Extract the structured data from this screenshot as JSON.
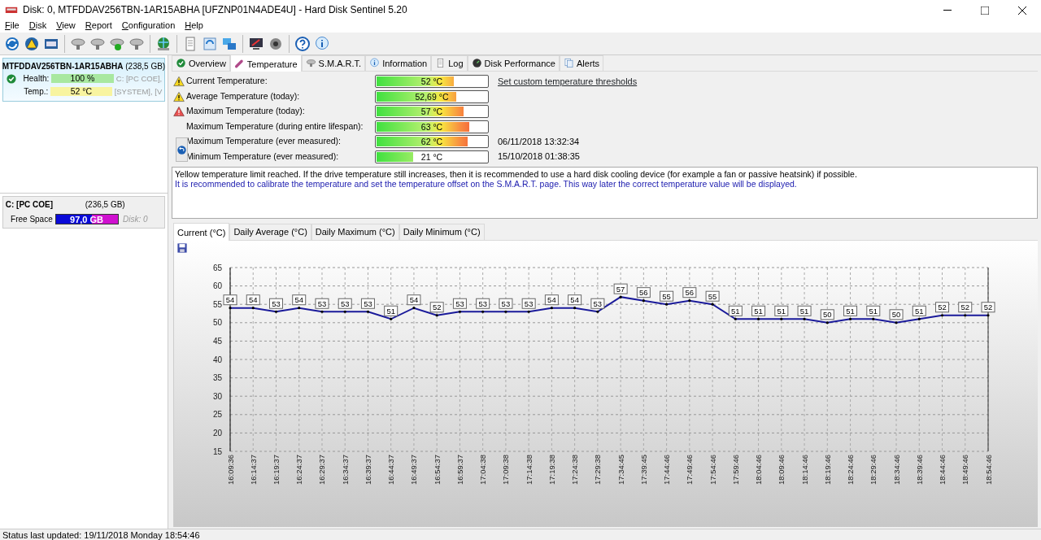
{
  "window": {
    "title": "Disk: 0, MTFDDAV256TBN-1AR15ABHA [UFZNP01N4ADE4U]  -  Hard Disk Sentinel 5.20"
  },
  "menu": [
    "File",
    "Disk",
    "View",
    "Report",
    "Configuration",
    "Help"
  ],
  "disk_card": {
    "name": "MTFDDAV256TBN-1AR15ABHA",
    "size": "(238,5 GB)",
    "rows": [
      {
        "label": "Health:",
        "value": "100 %",
        "color": "#a8e8a0",
        "extra": "C: [PC COE],"
      },
      {
        "label": "Temp.:",
        "value": "52 °C",
        "color": "#f8f4a0",
        "extra": "[SYSTEM],  [V"
      }
    ]
  },
  "partition": {
    "name": "C: [PC COE]",
    "size": "(236,5 GB)",
    "label": "Free Space",
    "value": "97,0 GB",
    "level": 0.59,
    "disk": "Disk: 0"
  },
  "tabs": [
    {
      "label": "Overview",
      "selected": false
    },
    {
      "label": "Temperature",
      "selected": true
    },
    {
      "label": "S.M.A.R.T.",
      "selected": false
    },
    {
      "label": "Information",
      "selected": false
    },
    {
      "label": "Log",
      "selected": false
    },
    {
      "label": "Disk Performance",
      "selected": false
    },
    {
      "label": "Alerts",
      "selected": false
    }
  ],
  "threshold_link": "Set custom temperature thresholds",
  "temperatures": [
    {
      "label": "Current Temperature:",
      "value": "52 °C",
      "level": 0.7,
      "kind": "warning"
    },
    {
      "label": "Average Temperature (today):",
      "value": "52,69 °C",
      "level": 0.72,
      "kind": "warning"
    },
    {
      "label": "Maximum Temperature (today):",
      "value": "57 °C",
      "level": 0.79,
      "kind": "critical"
    },
    {
      "label": "Maximum Temperature (during entire lifespan):",
      "value": "63 °C",
      "level": 0.84,
      "kind": "plain"
    },
    {
      "label": "Maximum Temperature (ever measured):",
      "value": "62 °C",
      "level": 0.82,
      "kind": "plain",
      "date": "06/11/2018 13:32:34"
    },
    {
      "label": "Minimum Temperature (ever measured):",
      "value": "21 °C",
      "level": 0.33,
      "kind": "plain",
      "date": "15/10/2018 01:38:35"
    }
  ],
  "messages": [
    {
      "kind": "warning",
      "text": "Yellow temperature limit reached. If the drive temperature still increases, then it is recommended to use a hard disk cooling device (for example a fan or passive heatsink) if possible."
    },
    {
      "kind": "advice",
      "text": "It is recommended to calibrate the temperature and set the temperature offset on the S.M.A.R.T. page. This way later the correct temperature value will be displayed."
    }
  ],
  "chart_tabs": [
    {
      "label": "Current (°C)",
      "selected": true
    },
    {
      "label": "Daily Average (°C)",
      "selected": false
    },
    {
      "label": "Daily Maximum (°C)",
      "selected": false
    },
    {
      "label": "Daily Minimum (°C)",
      "selected": false
    }
  ],
  "chart_data": {
    "type": "line",
    "data_labels": true,
    "grid": true,
    "ylim": [
      15,
      65
    ],
    "yticks": [
      15,
      20,
      25,
      30,
      35,
      40,
      45,
      50,
      55,
      60,
      65
    ],
    "categories": [
      "16:09:36",
      "16:14:37",
      "16:19:37",
      "16:24:37",
      "16:29:37",
      "16:34:37",
      "16:39:37",
      "16:44:37",
      "16:49:37",
      "16:54:37",
      "16:59:37",
      "17:04:38",
      "17:09:38",
      "17:14:38",
      "17:19:38",
      "17:24:38",
      "17:29:38",
      "17:34:45",
      "17:39:45",
      "17:44:46",
      "17:49:46",
      "17:54:46",
      "17:59:46",
      "18:04:46",
      "18:09:46",
      "18:14:46",
      "18:19:46",
      "18:24:46",
      "18:29:46",
      "18:34:46",
      "18:39:46",
      "18:44:46",
      "18:49:46",
      "18:54:46"
    ],
    "series": [
      {
        "color": "#1a1a9a",
        "values": [
          54,
          54,
          53,
          54,
          53,
          53,
          53,
          51,
          54,
          52,
          53,
          53,
          53,
          53,
          54,
          54,
          53,
          57,
          56,
          55,
          56,
          55,
          51,
          51,
          51,
          51,
          50,
          51,
          51,
          50,
          51,
          52,
          52,
          52
        ]
      }
    ]
  },
  "status_bar": "Status last updated: 19/11/2018 Monday 18:54:46"
}
